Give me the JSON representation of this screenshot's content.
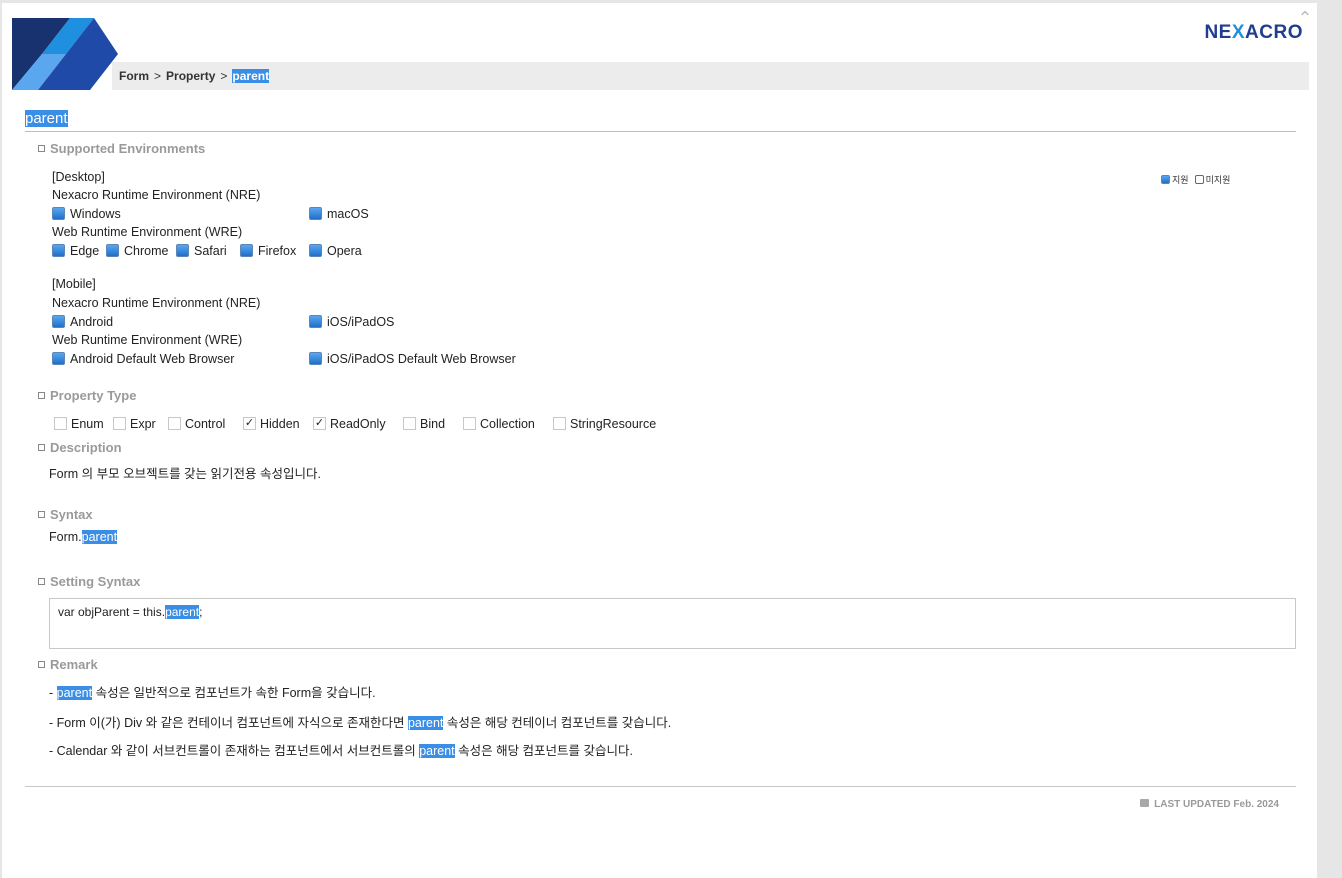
{
  "header": {
    "brand": "NEXACRO",
    "breadcrumb": [
      "Form",
      "Property",
      "parent"
    ]
  },
  "page_title": "parent",
  "sections": {
    "supported": "Supported Environments",
    "property_type": "Property Type",
    "description": "Description",
    "syntax": "Syntax",
    "setting_syntax": "Setting Syntax",
    "remark": "Remark"
  },
  "legend": {
    "supported": "지원",
    "unsupported": "미지원"
  },
  "desktop": {
    "label": "[Desktop]",
    "nre": "Nexacro Runtime Environment (NRE)",
    "nre_items": [
      "Windows",
      "macOS"
    ],
    "wre": "Web Runtime Environment (WRE)",
    "wre_items": [
      "Edge",
      "Chrome",
      "Safari",
      "Firefox",
      "Opera"
    ]
  },
  "mobile": {
    "label": "[Mobile]",
    "nre": "Nexacro Runtime Environment (NRE)",
    "nre_items": [
      "Android",
      "iOS/iPadOS"
    ],
    "wre": "Web Runtime Environment (WRE)",
    "wre_items": [
      "Android Default Web Browser",
      "iOS/iPadOS Default Web Browser"
    ]
  },
  "property_types": [
    {
      "label": "Enum",
      "checked": false
    },
    {
      "label": "Expr",
      "checked": false
    },
    {
      "label": "Control",
      "checked": false
    },
    {
      "label": "Hidden",
      "checked": true
    },
    {
      "label": "ReadOnly",
      "checked": true
    },
    {
      "label": "Bind",
      "checked": false
    },
    {
      "label": "Collection",
      "checked": false
    },
    {
      "label": "StringResource",
      "checked": false
    }
  ],
  "description": "Form 의 부모 오브젝트를 갖는 읽기전용 속성입니다.",
  "syntax": {
    "prefix": "Form.",
    "highlight": "parent"
  },
  "setting_syntax": {
    "prefix": "var objParent = this.",
    "highlight": "parent",
    "suffix": ";"
  },
  "remarks": [
    {
      "pre": "- ",
      "hl": "parent",
      "post": " 속성은 일반적으로 컴포넌트가 속한 Form을 갖습니다."
    },
    {
      "pre": "- Form 이(가) Div 와 같은 컨테이너 컴포넌트에 자식으로 존재한다면 ",
      "hl": "parent",
      "post": " 속성은 해당 컨테이너 컴포넌트를 갖습니다."
    },
    {
      "pre": "- Calendar 와 같이 서브컨트롤이 존재하는 컴포넌트에서 서브컨트롤의 ",
      "hl": "parent",
      "post": " 속성은 해당 컴포넌트를 갖습니다."
    }
  ],
  "footer": {
    "updated": "LAST UPDATED Feb. 2024"
  },
  "colors": {
    "accent": "#3a8ee6",
    "brand_dark": "#1f3e8f",
    "brand_light": "#1f8fe0"
  },
  "icons": [
    "nexacro-logo-icon",
    "scroll-up-icon",
    "checkbox-checked-icon",
    "last-updated-icon"
  ]
}
